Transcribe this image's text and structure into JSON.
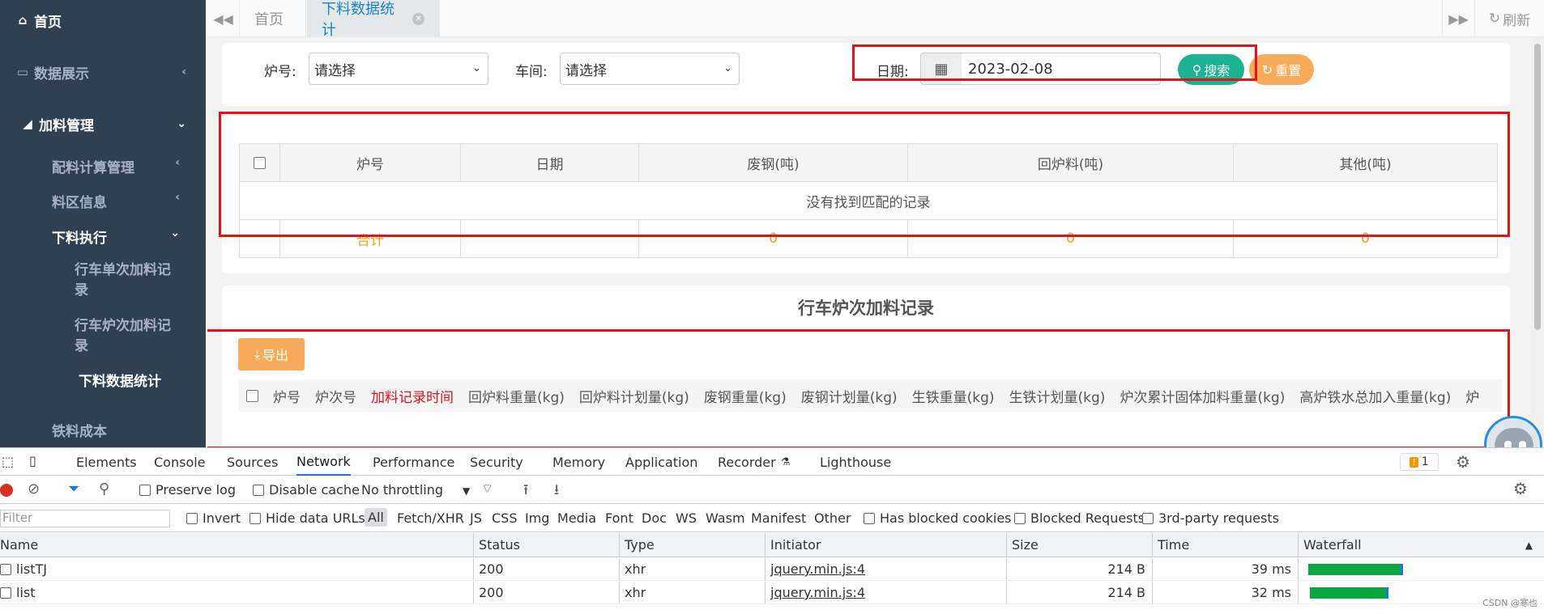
{
  "sidebar": {
    "home": "首页",
    "data_display": "数据展示",
    "charging_mgmt": "加料管理",
    "sub": {
      "batching_calc": "配料计算管理",
      "material_area": "料区信息",
      "discharge_exec": "下料执行"
    },
    "subsub": {
      "crane_single": "行车单次加料记录",
      "crane_heat": "行车炉次加料记录",
      "discharge_stats": "下料数据统计"
    },
    "iron_cost": "铁料成本"
  },
  "tabbar": {
    "home_tab": "首页",
    "current_tab": "下料数据统计",
    "refresh": "刷新"
  },
  "search": {
    "furnace_label": "炉号:",
    "furnace_value": "请选择",
    "workshop_label": "车间:",
    "workshop_value": "请选择",
    "date_label": "日期:",
    "date_value": "2023-02-08",
    "search_btn": "搜索",
    "reset_btn": "重置"
  },
  "summary_table": {
    "headers": [
      "炉号",
      "日期",
      "废钢(吨)",
      "回炉料(吨)",
      "其他(吨)"
    ],
    "empty_text": "没有找到匹配的记录",
    "total_label": "合计",
    "totals": [
      "0",
      "0",
      "0"
    ]
  },
  "detail": {
    "title": "行车炉次加料记录",
    "export_btn": "导出",
    "columns": [
      "炉号",
      "炉次号",
      "加料记录时间",
      "回炉料重量(kg)",
      "回炉料计划量(kg)",
      "废钢重量(kg)",
      "废钢计划量(kg)",
      "生铁重量(kg)",
      "生铁计划量(kg)",
      "炉次累计固体加料重量(kg)",
      "高炉铁水总加入重量(kg)",
      "炉"
    ]
  },
  "devtools": {
    "tabs": [
      "Elements",
      "Console",
      "Sources",
      "Network",
      "Performance",
      "Security",
      "Memory",
      "Application",
      "Recorder",
      "Lighthouse"
    ],
    "issues_count": "1",
    "toolbar": {
      "preserve_log": "Preserve log",
      "disable_cache": "Disable cache",
      "throttling": "No throttling"
    },
    "filter": {
      "placeholder": "Filter",
      "invert": "Invert",
      "hide_data_urls": "Hide data URLs",
      "types": [
        "All",
        "Fetch/XHR",
        "JS",
        "CSS",
        "Img",
        "Media",
        "Font",
        "Doc",
        "WS",
        "Wasm",
        "Manifest",
        "Other"
      ],
      "has_blocked_cookies": "Has blocked cookies",
      "blocked_requests": "Blocked Requests",
      "third_party": "3rd-party requests"
    },
    "grid_headers": [
      "Name",
      "Status",
      "Type",
      "Initiator",
      "Size",
      "Time",
      "Waterfall"
    ],
    "rows": [
      {
        "name": "listTJ",
        "status": "200",
        "type": "xhr",
        "initiator": "jquery.min.js:4",
        "size": "214 B",
        "time": "39 ms"
      },
      {
        "name": "list",
        "status": "200",
        "type": "xhr",
        "initiator": "jquery.min.js:4",
        "size": "214 B",
        "time": "32 ms"
      }
    ],
    "watermark": "CSDN @寒也"
  },
  "colors": {
    "sidebar_bg": "#2f4050",
    "primary_green": "#1ab394",
    "warning_orange": "#f8ac59",
    "annotation_red": "#e2141b",
    "tab_active_text": "#1c84c6"
  }
}
